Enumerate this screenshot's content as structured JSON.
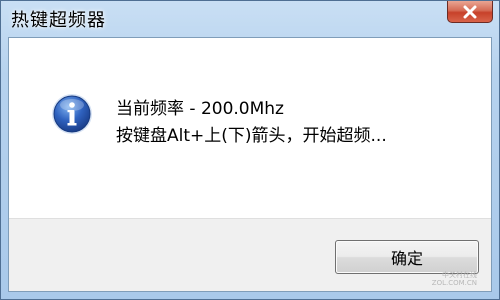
{
  "window": {
    "title": "热键超频器"
  },
  "dialog": {
    "icon": "info-icon",
    "message_line1": "当前频率 - 200.0Mhz",
    "message_line2": "按键盘Alt+上(下)箭头，开始超频...",
    "ok_label": "确定"
  },
  "watermark": {
    "line1": "中关村在线",
    "line2": "ZOL.COM.CN"
  },
  "colors": {
    "title_bar": "#b6d2ee",
    "close_button": "#c7412a",
    "client_bg": "#ffffff",
    "footer_bg": "#f0f0f0",
    "info_icon": "#2f62bf"
  }
}
